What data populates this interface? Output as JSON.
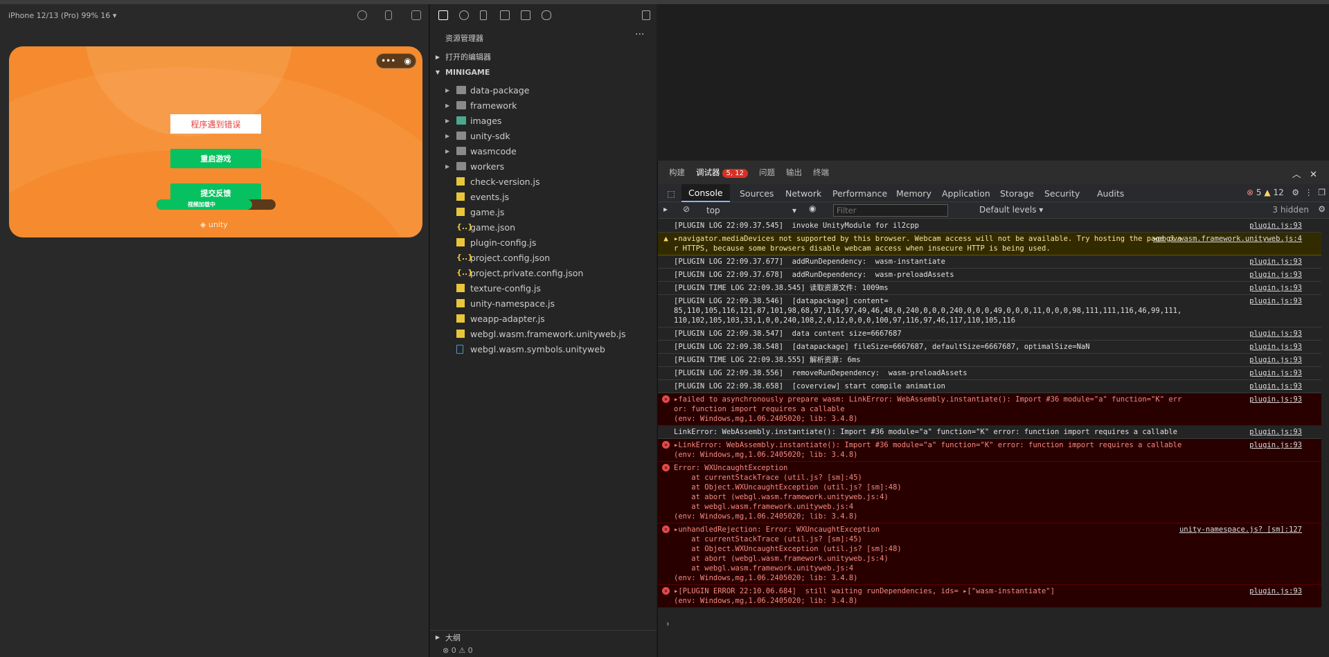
{
  "simulator": {
    "device_label": "iPhone 12/13 (Pro) 99% 16 ▾",
    "error_text": "程序遇到错误",
    "restart_label": "重启游戏",
    "feedback_label": "提交反馈",
    "progress_text": "视频加载中",
    "progress_fraction": 0.8,
    "unity_label": "unity",
    "capsule_more": "•••",
    "capsule_close": "◉"
  },
  "explorer": {
    "title": "资源管理器",
    "more": "···",
    "open_editors": "打开的编辑器",
    "project": "MINIGAME",
    "folders": [
      "data-package",
      "framework",
      "images",
      "unity-sdk",
      "wasmcode",
      "workers"
    ],
    "files": [
      {
        "name": "check-version.js",
        "kind": "js"
      },
      {
        "name": "events.js",
        "kind": "js"
      },
      {
        "name": "game.js",
        "kind": "js"
      },
      {
        "name": "game.json",
        "kind": "json"
      },
      {
        "name": "plugin-config.js",
        "kind": "js"
      },
      {
        "name": "project.config.json",
        "kind": "json"
      },
      {
        "name": "project.private.config.json",
        "kind": "json"
      },
      {
        "name": "texture-config.js",
        "kind": "js"
      },
      {
        "name": "unity-namespace.js",
        "kind": "js"
      },
      {
        "name": "weapp-adapter.js",
        "kind": "js"
      },
      {
        "name": "webgl.wasm.framework.unityweb.js",
        "kind": "js"
      },
      {
        "name": "webgl.wasm.symbols.unityweb",
        "kind": "file"
      }
    ],
    "outline": "大纲",
    "status": "⊗ 0 ⚠ 0"
  },
  "devtools": {
    "tabs": [
      "构建",
      "调试器",
      "问题",
      "输出",
      "终端"
    ],
    "badge": "5, 12",
    "cdp_tabs": [
      "Console",
      "Sources",
      "Network",
      "Performance",
      "Memory",
      "Application",
      "Storage",
      "Security",
      "Audits"
    ],
    "errors_count": "5",
    "warnings_count": "12",
    "context": "top",
    "filter_placeholder": "Filter",
    "levels": "Default levels ▾",
    "hidden": "3 hidden",
    "logs": [
      {
        "type": "plain",
        "text": "[PLUGIN LOG 22:09.37.545]  invoke UnityModule for il2cpp",
        "src": "plugin.js:93"
      },
      {
        "type": "warn",
        "text": "▸navigator.mediaDevices not supported by this browser. Webcam access will not be available. Try hosting the page over HTTPS, because some browsers disable webcam access when insecure HTTP is being used.",
        "src": "webgl.wasm.framework.unityweb.js:4"
      },
      {
        "type": "plain",
        "text": "[PLUGIN LOG 22:09.37.677]  addRunDependency:  wasm-instantiate",
        "src": "plugin.js:93"
      },
      {
        "type": "plain",
        "text": "[PLUGIN LOG 22:09.37.678]  addRunDependency:  wasm-preloadAssets",
        "src": "plugin.js:93"
      },
      {
        "type": "plain",
        "text": "[PLUGIN TIME LOG 22:09.38.545] 读取资源文件: 1009ms",
        "src": "plugin.js:93"
      },
      {
        "type": "plain",
        "text": "[PLUGIN LOG 22:09.38.546]  [datapackage] content=\n85,110,105,116,121,87,101,98,68,97,116,97,49,46,48,0,240,0,0,0,240,0,0,0,49,0,0,0,11,0,0,0,98,111,111,116,46,99,111,110,102,105,103,33,1,0,0,240,108,2,0,12,0,0,0,100,97,116,97,46,117,110,105,116",
        "src": "plugin.js:93"
      },
      {
        "type": "plain",
        "text": "[PLUGIN LOG 22:09.38.547]  data content size=6667687",
        "src": "plugin.js:93"
      },
      {
        "type": "plain",
        "text": "[PLUGIN LOG 22:09.38.548]  [datapackage] fileSize=6667687, defaultSize=6667687, optimalSize=NaN",
        "src": "plugin.js:93"
      },
      {
        "type": "plain",
        "text": "[PLUGIN TIME LOG 22:09.38.555] 解析资源: 6ms",
        "src": "plugin.js:93"
      },
      {
        "type": "plain",
        "text": "[PLUGIN LOG 22:09.38.556]  removeRunDependency:  wasm-preloadAssets",
        "src": "plugin.js:93"
      },
      {
        "type": "plain",
        "text": "[PLUGIN LOG 22:09.38.658]  [coverview] start compile animation",
        "src": "plugin.js:93"
      },
      {
        "type": "error",
        "text": "▸failed to asynchronously prepare wasm: LinkError: WebAssembly.instantiate(): Import #36 module=\"a\" function=\"K\" error: function import requires a callable\n(env: Windows,mg,1.06.2405020; lib: 3.4.8)",
        "src": "plugin.js:93"
      },
      {
        "type": "plain",
        "text": "LinkError: WebAssembly.instantiate(): Import #36 module=\"a\" function=\"K\" error: function import requires a callable",
        "src": "plugin.js:93"
      },
      {
        "type": "error",
        "text": "▸LinkError: WebAssembly.instantiate(): Import #36 module=\"a\" function=\"K\" error: function import requires a callable\n(env: Windows,mg,1.06.2405020; lib: 3.4.8)",
        "src": "plugin.js:93"
      },
      {
        "type": "error",
        "text": "Error: WXUncaughtException\n    at currentStackTrace (util.js? [sm]:45)\n    at Object.WXUncaughtException (util.js? [sm]:48)\n    at abort (webgl.wasm.framework.unityweb.js:4)\n    at webgl.wasm.framework.unityweb.js:4\n(env: Windows,mg,1.06.2405020; lib: 3.4.8)",
        "src": ""
      },
      {
        "type": "error",
        "text": "▸unhandledRejection: Error: WXUncaughtException\n    at currentStackTrace (util.js? [sm]:45)\n    at Object.WXUncaughtException (util.js? [sm]:48)\n    at abort (webgl.wasm.framework.unityweb.js:4)\n    at webgl.wasm.framework.unityweb.js:4\n(env: Windows,mg,1.06.2405020; lib: 3.4.8)",
        "src": "unity-namespace.js? [sm]:127"
      },
      {
        "type": "error",
        "text": "▸[PLUGIN ERROR 22:10.06.684]  still waiting runDependencies, ids= ▸[\"wasm-instantiate\"]\n(env: Windows,mg,1.06.2405020; lib: 3.4.8)",
        "src": "plugin.js:93"
      }
    ],
    "prompt": "›"
  },
  "colors": {
    "accent_green": "#07c160",
    "phone_orange": "#f58b2e",
    "error_red": "#f28b82",
    "warn_yellow": "#fdd663"
  }
}
